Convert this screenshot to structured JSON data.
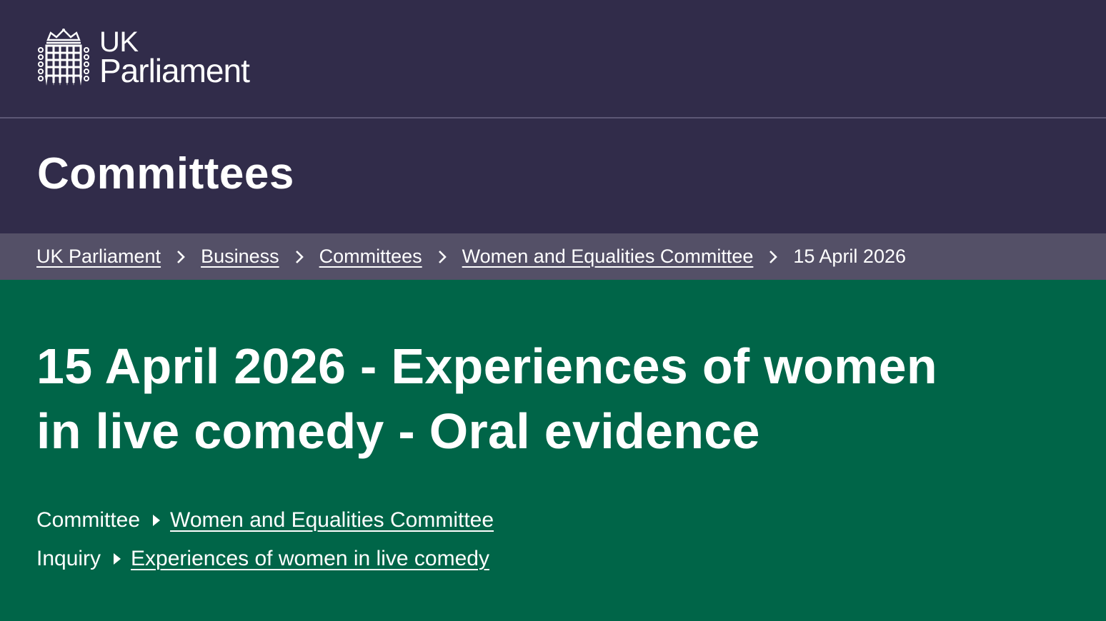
{
  "header": {
    "logo_line1": "UK",
    "logo_line2": "Parliament",
    "logo_icon": "portcullis-icon"
  },
  "section": {
    "title": "Committees"
  },
  "breadcrumb": {
    "items": [
      {
        "label": "UK Parliament"
      },
      {
        "label": "Business"
      },
      {
        "label": "Committees"
      },
      {
        "label": "Women and Equalities Committee"
      }
    ],
    "current": "15 April 2026",
    "separator_icon": "chevron-right-icon"
  },
  "page": {
    "title": "15 April 2026 - Experiences of women in live comedy - Oral evidence",
    "meta": [
      {
        "label": "Committee",
        "link": "Women and Equalities Committee"
      },
      {
        "label": "Inquiry",
        "link": "Experiences of women in live comedy"
      }
    ]
  },
  "colors": {
    "header_bg": "#312c4a",
    "breadcrumb_bg": "#545067",
    "hero_bg": "#006548",
    "text": "#ffffff"
  }
}
